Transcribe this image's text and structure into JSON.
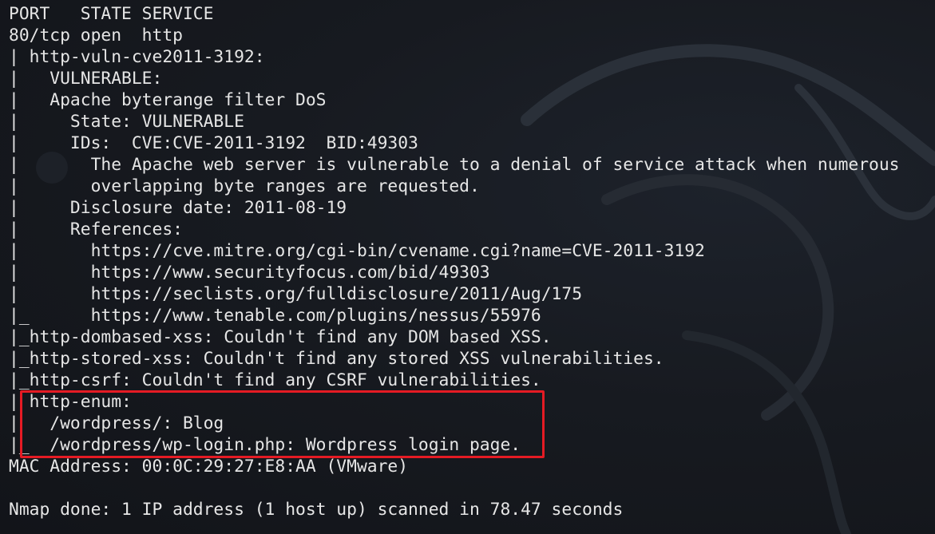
{
  "terminal": {
    "lines": [
      "PORT   STATE SERVICE",
      "80/tcp open  http",
      "| http-vuln-cve2011-3192:",
      "|   VULNERABLE:",
      "|   Apache byterange filter DoS",
      "|     State: VULNERABLE",
      "|     IDs:  CVE:CVE-2011-3192  BID:49303",
      "|       The Apache web server is vulnerable to a denial of service attack when numerous",
      "|       overlapping byte ranges are requested.",
      "|     Disclosure date: 2011-08-19",
      "|     References:",
      "|       https://cve.mitre.org/cgi-bin/cvename.cgi?name=CVE-2011-3192",
      "|       https://www.securityfocus.com/bid/49303",
      "|       https://seclists.org/fulldisclosure/2011/Aug/175",
      "|_      https://www.tenable.com/plugins/nessus/55976",
      "|_http-dombased-xss: Couldn't find any DOM based XSS.",
      "|_http-stored-xss: Couldn't find any stored XSS vulnerabilities.",
      "|_http-csrf: Couldn't find any CSRF vulnerabilities.",
      "| http-enum:",
      "|   /wordpress/: Blog",
      "|_  /wordpress/wp-login.php: Wordpress login page.",
      "MAC Address: 00:0C:29:27:E8:AA (VMware)",
      "",
      "Nmap done: 1 IP address (1 host up) scanned in 78.47 seconds"
    ]
  },
  "colors": {
    "text": "#e6e6e6",
    "background": "#14161b",
    "highlight": "#e51b24"
  }
}
